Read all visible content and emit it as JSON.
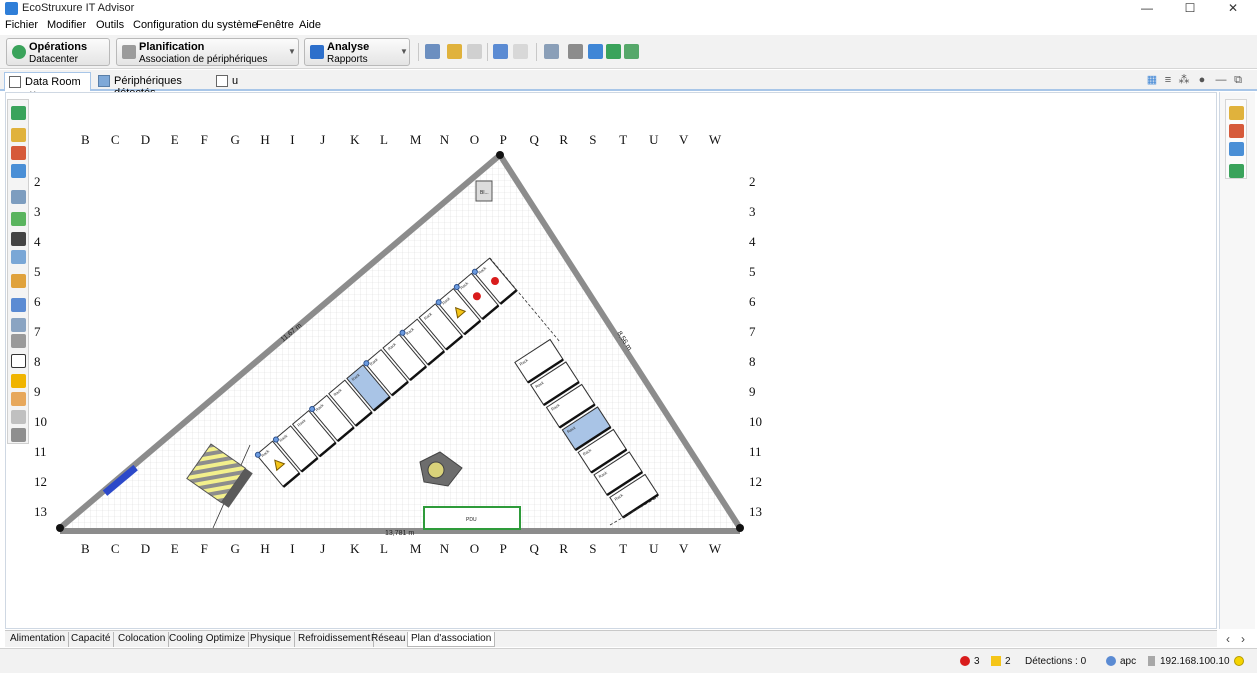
{
  "app": {
    "title": "EcoStruxure IT Advisor"
  },
  "menu": [
    "Fichier",
    "Modifier",
    "Outils",
    "Configuration du système",
    "Fenêtre",
    "Aide"
  ],
  "perspectives": [
    {
      "title": "Opérations",
      "subtitle": "Datacenter",
      "color": "#3aa35b"
    },
    {
      "title": "Planification",
      "subtitle": "Association de périphériques",
      "color": "#7d7d7d"
    },
    {
      "title": "Analyse",
      "subtitle": "Rapports",
      "color": "#2d6fcb"
    }
  ],
  "editor_tabs": [
    {
      "label": "Data Room",
      "active": true,
      "closable": true
    },
    {
      "label": "Périphériques détectés",
      "active": false,
      "closable": false
    },
    {
      "label": "u",
      "active": false,
      "closable": false
    }
  ],
  "floor_plan": {
    "col_labels": [
      "B",
      "C",
      "D",
      "E",
      "F",
      "G",
      "H",
      "I",
      "J",
      "K",
      "L",
      "M",
      "N",
      "O",
      "P",
      "Q",
      "R",
      "S",
      "T",
      "U",
      "V",
      "W"
    ],
    "row_labels": [
      "2",
      "3",
      "4",
      "5",
      "6",
      "7",
      "8",
      "9",
      "10",
      "11",
      "12",
      "13"
    ],
    "wall_labels": {
      "left": "11,67 m",
      "right": "8,56 m",
      "bottom": "13,781 m"
    },
    "pdu_label": "PDU",
    "upper_rack_label": "Rack",
    "device_label": "Bl...",
    "colors": {
      "wall": "#8c8c8c",
      "blue_rack": "#a9c4e6",
      "alarm": "#d91c1c",
      "warning": "#f5c518",
      "pdu_border": "#2e9b3a"
    }
  },
  "bottom_tabs": [
    "Alimentation",
    "Capacité",
    "Colocation",
    "Cooling Optimize",
    "Physique",
    "Refroidissement",
    "Réseau",
    "Plan d'association"
  ],
  "active_bottom_tab": "Plan d'association",
  "status": {
    "errors": "3",
    "warnings": "2",
    "detections": "Détections : 0",
    "user": "apc",
    "ip": "192.168.100.10"
  }
}
